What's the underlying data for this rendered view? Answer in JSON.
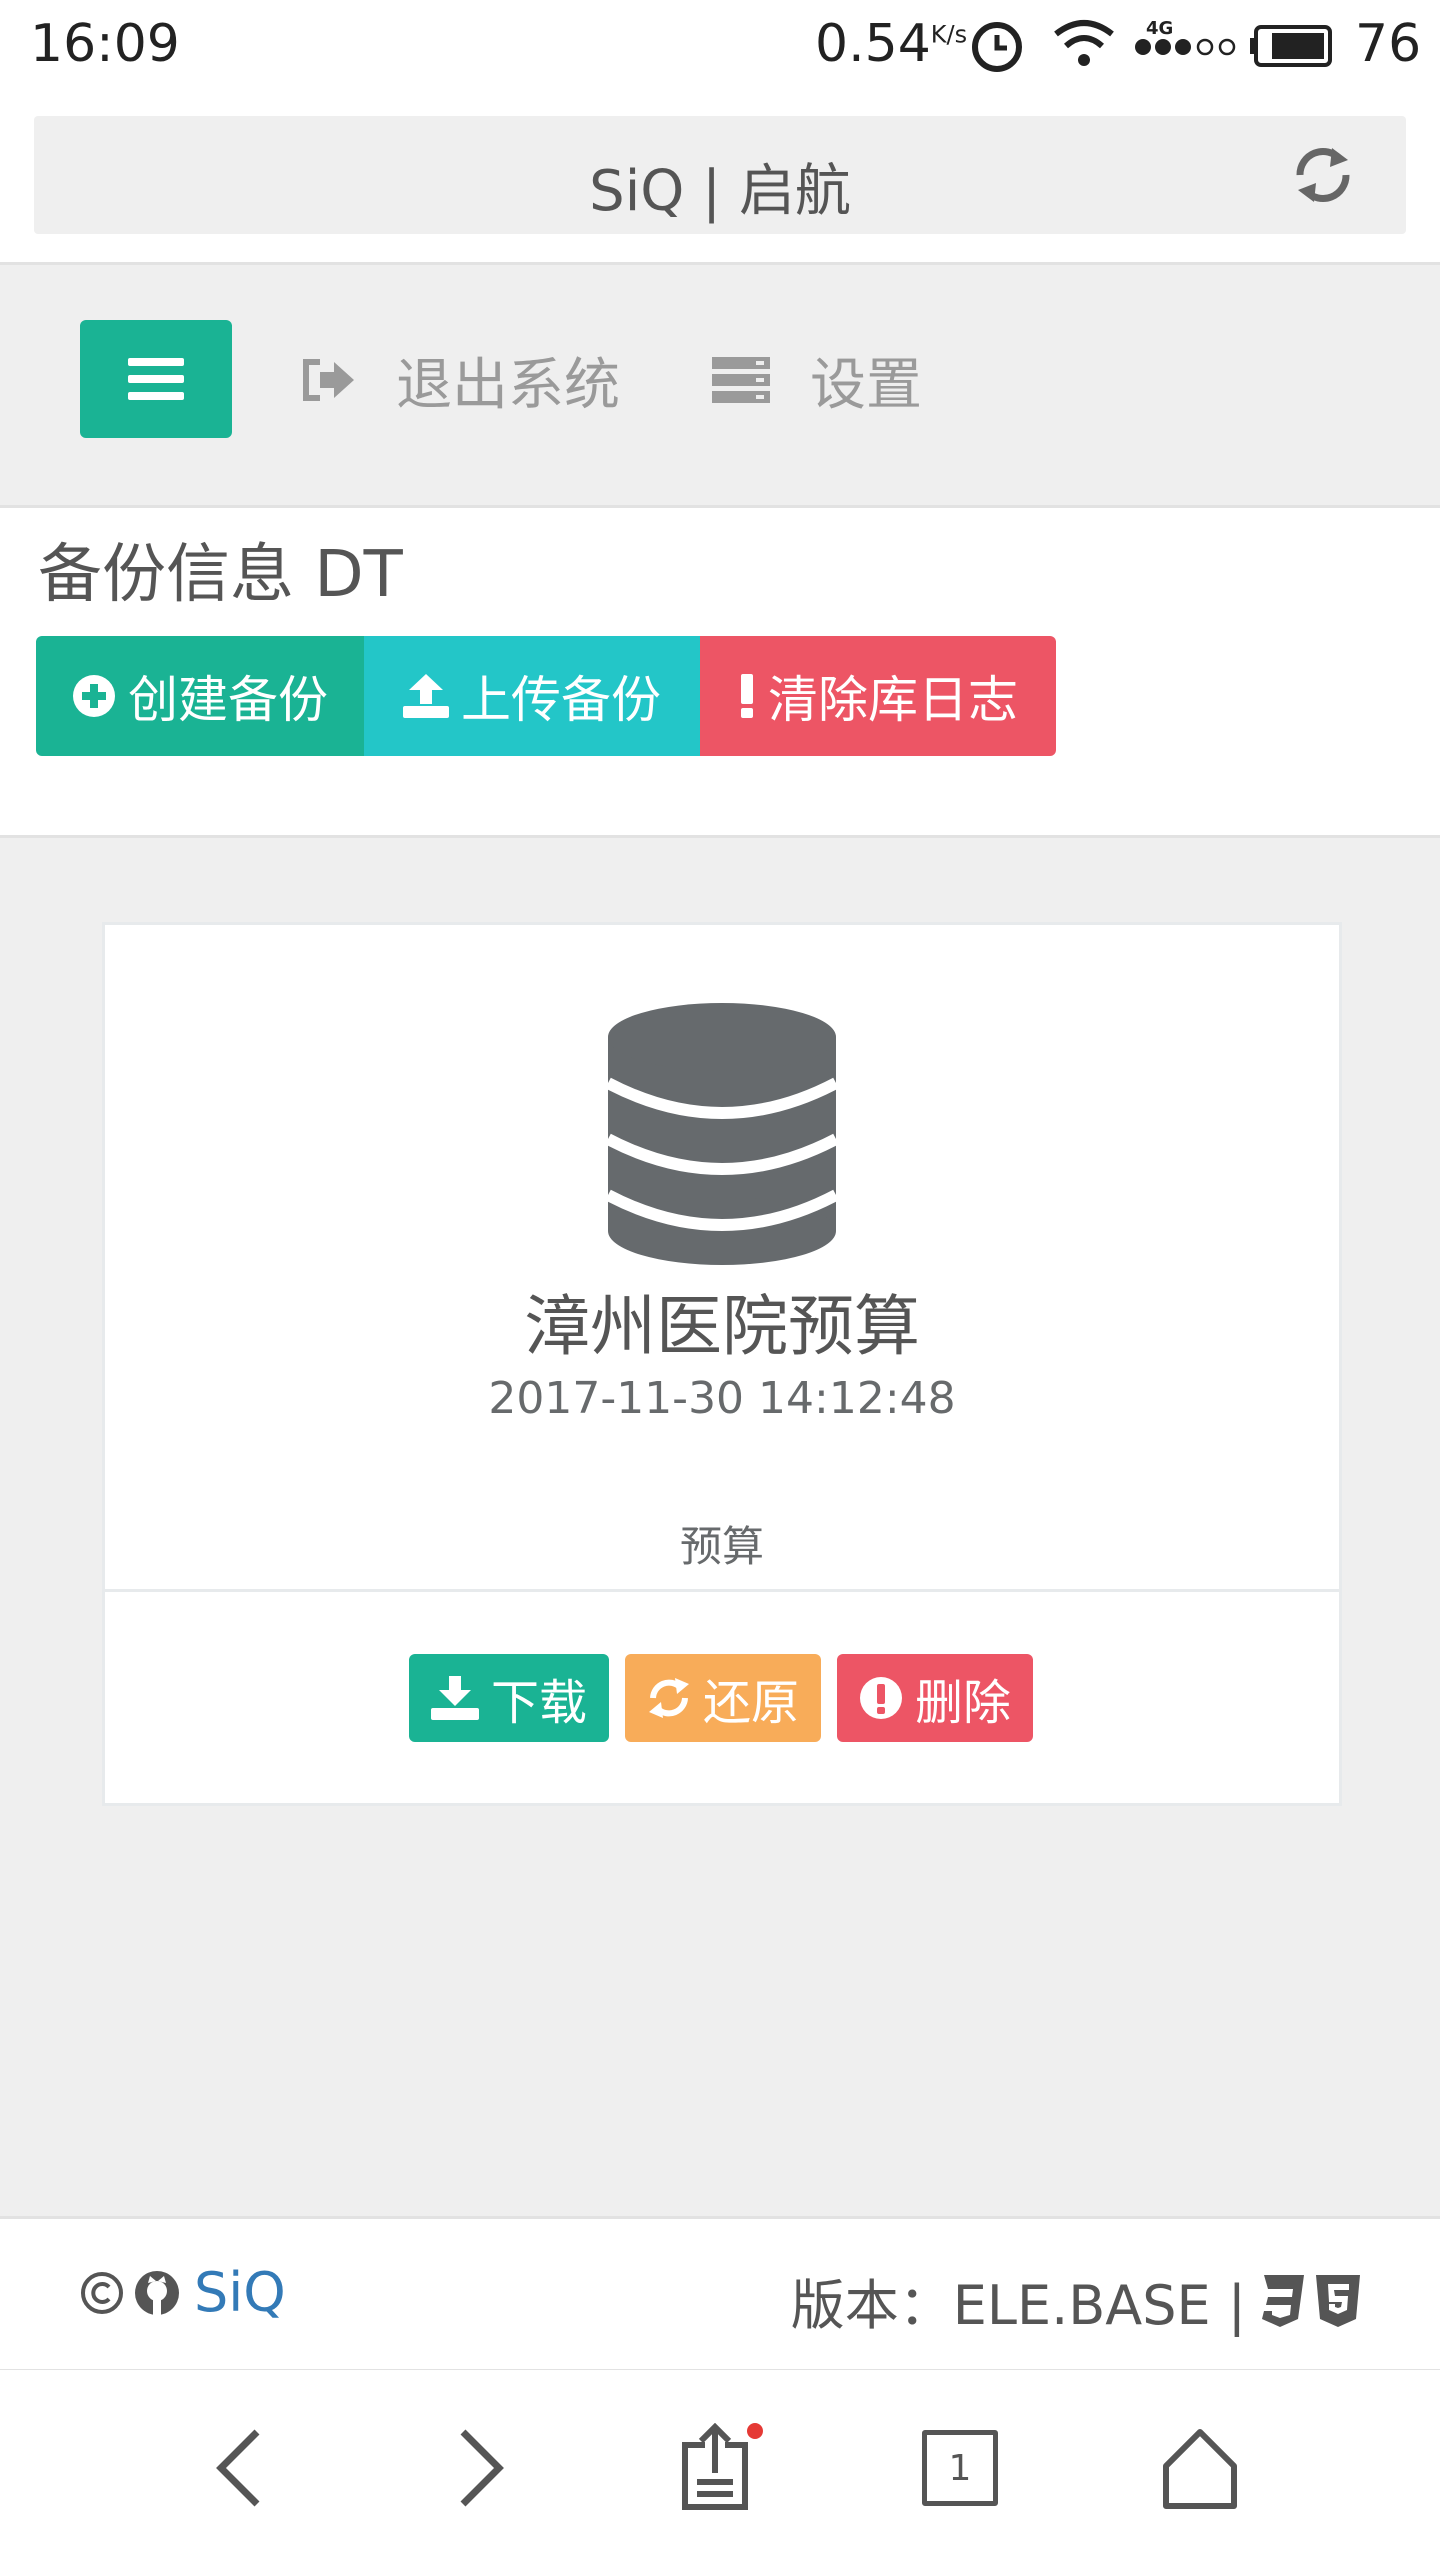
{
  "status_bar": {
    "time": "16:09",
    "net_speed": "0.54",
    "net_unit": "K/s",
    "signal": "4G",
    "battery": "76"
  },
  "browser": {
    "url_title": "SiQ | 启航",
    "tabs_count": "1"
  },
  "nav": {
    "logout_label": "退出系统",
    "settings_label": "设置"
  },
  "section": {
    "title": "备份信息 DT",
    "create_label": "创建备份",
    "upload_label": "上传备份",
    "clear_label": "清除库日志"
  },
  "card": {
    "title": "漳州医院预算",
    "time": "2017-11-30 14:12:48",
    "tag": "预算",
    "download_label": "下载",
    "restore_label": "还原",
    "delete_label": "删除"
  },
  "footer": {
    "link_text": "SiQ",
    "version": "版本：ELE.BASE |"
  },
  "colors": {
    "primary": "#1ab394",
    "info": "#23c6c8",
    "danger": "#ed5565",
    "warning": "#f8ac59",
    "link": "#337ab7"
  }
}
